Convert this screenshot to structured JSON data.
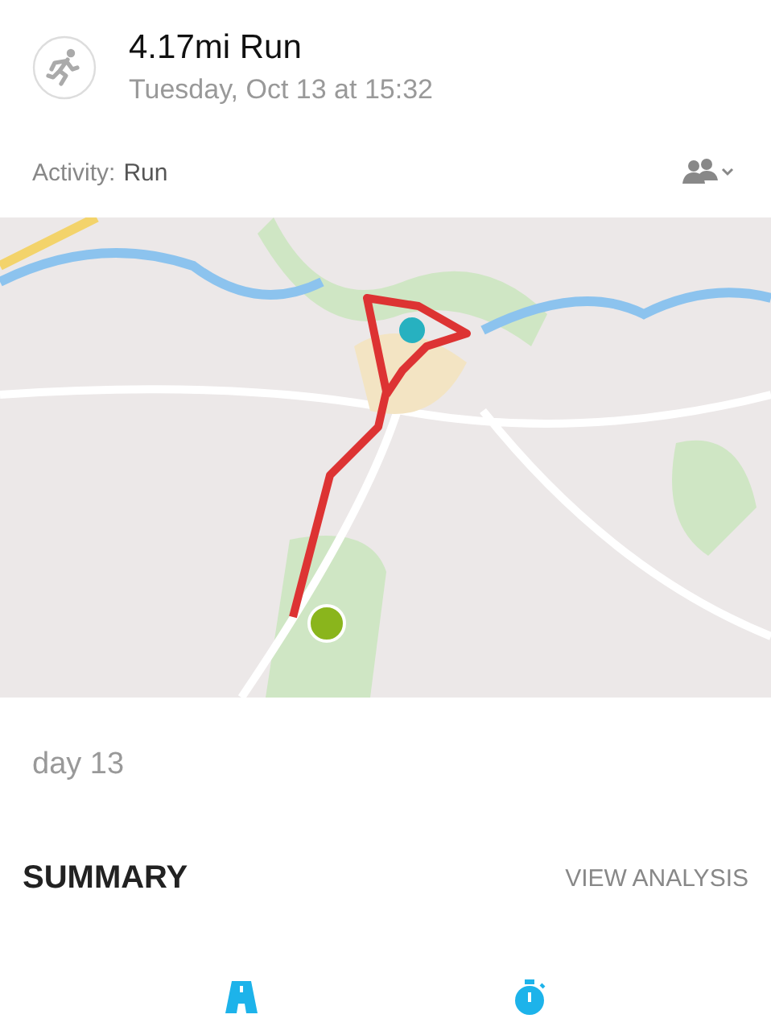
{
  "header": {
    "title": "4.17mi Run",
    "subtitle": "Tuesday, Oct 13 at 15:32"
  },
  "activity": {
    "label": "Activity:",
    "value": "Run"
  },
  "description": "day 13",
  "summary": {
    "title": "SUMMARY",
    "action": "VIEW ANALYSIS"
  }
}
